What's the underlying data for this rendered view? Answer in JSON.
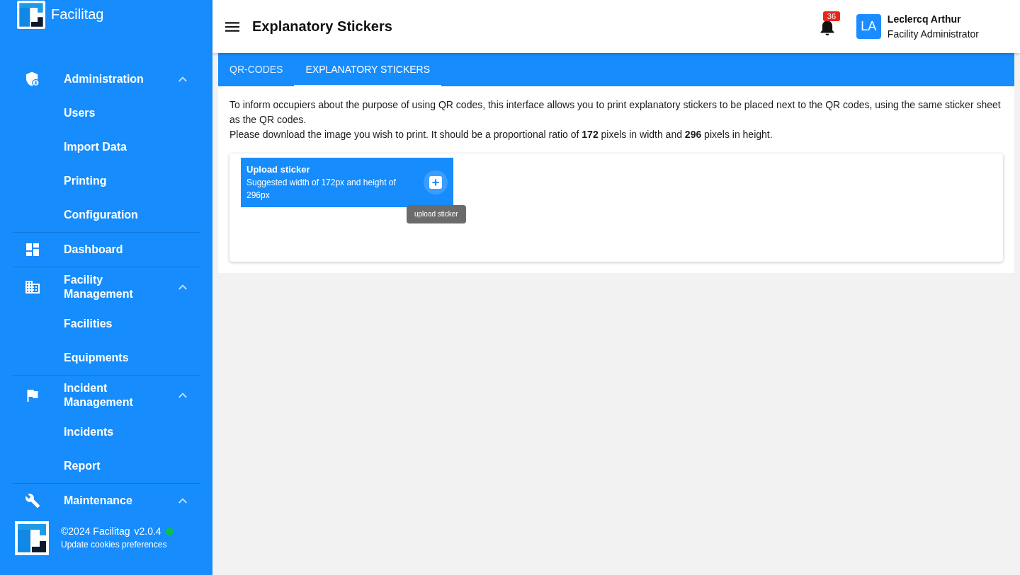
{
  "sidebar": {
    "brand": "Facilitag",
    "nav": [
      {
        "kind": "group",
        "label": "Administration",
        "expanded": true,
        "children": [
          {
            "label": "Users"
          },
          {
            "label": "Import Data"
          },
          {
            "label": "Printing"
          },
          {
            "label": "Configuration"
          }
        ]
      },
      {
        "kind": "link",
        "label": "Dashboard"
      },
      {
        "kind": "group",
        "label": "Facility Management",
        "expanded": true,
        "children": [
          {
            "label": "Facilities"
          },
          {
            "label": "Equipments"
          }
        ]
      },
      {
        "kind": "group",
        "label": "Incident Management",
        "expanded": true,
        "children": [
          {
            "label": "Incidents"
          },
          {
            "label": "Report"
          }
        ]
      },
      {
        "kind": "group",
        "label": "Maintenance",
        "expanded": true
      }
    ],
    "footer": {
      "copyright": "©2024 Facilitag",
      "version": "v2.0.4",
      "online": true,
      "cookies_link": "Update cookies preferences"
    }
  },
  "header": {
    "title": "Explanatory Stickers",
    "notifications": "36",
    "user": {
      "initials": "LA",
      "name": "Leclercq Arthur",
      "role": "Facility Administrator"
    }
  },
  "tabs": [
    {
      "label": "QR-CODES",
      "selected": false
    },
    {
      "label": "EXPLANATORY STICKERS",
      "selected": true
    }
  ],
  "intro": [
    "To inform occupiers about the purpose of using QR codes, this interface allows you to print explanatory stickers to be placed next to the QR codes, using the same sticker sheet as the QR codes.",
    "Please download the image you wish to print. It should be a proportional ratio of **172** pixels in width and **296** pixels in height."
  ],
  "upload": {
    "title": "Upload sticker",
    "hint": "Suggested width of 172px and height of 296px",
    "tooltip": "upload sticker"
  }
}
